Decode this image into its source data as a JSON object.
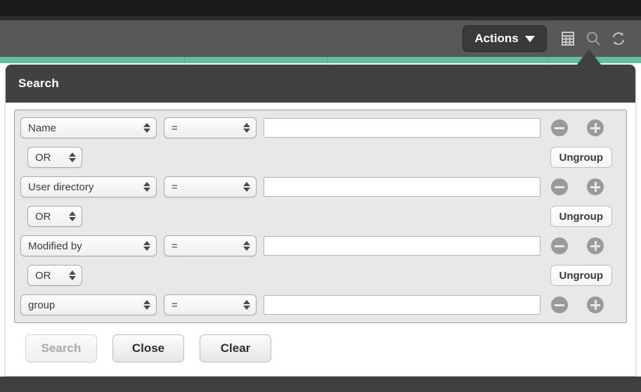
{
  "toolbar": {
    "actions_label": "Actions",
    "icons": [
      {
        "name": "table-view-icon",
        "glyph": "table"
      },
      {
        "name": "search-icon",
        "glyph": "magnifier"
      },
      {
        "name": "refresh-icon",
        "glyph": "refresh"
      }
    ],
    "accent_color": "#5fbfa0",
    "bar_color": "#585858"
  },
  "popup": {
    "title": "Search",
    "rows": [
      {
        "field": "Name",
        "operator": "=",
        "value": "",
        "remove_label": "remove-condition",
        "add_label": "add-condition"
      },
      {
        "field": "User directory",
        "operator": "=",
        "value": "",
        "remove_label": "remove-condition",
        "add_label": "add-condition"
      },
      {
        "field": "Modified by",
        "operator": "=",
        "value": "",
        "remove_label": "remove-condition",
        "add_label": "add-condition"
      },
      {
        "field": "group",
        "operator": "=",
        "value": "",
        "remove_label": "remove-condition",
        "add_label": "add-condition"
      }
    ],
    "boolean_rows": [
      {
        "operator": "OR",
        "ungroup_label": "Ungroup"
      },
      {
        "operator": "OR",
        "ungroup_label": "Ungroup"
      },
      {
        "operator": "OR",
        "ungroup_label": "Ungroup"
      }
    ],
    "footer": {
      "search_label": "Search",
      "close_label": "Close",
      "clear_label": "Clear",
      "search_enabled": false
    }
  }
}
